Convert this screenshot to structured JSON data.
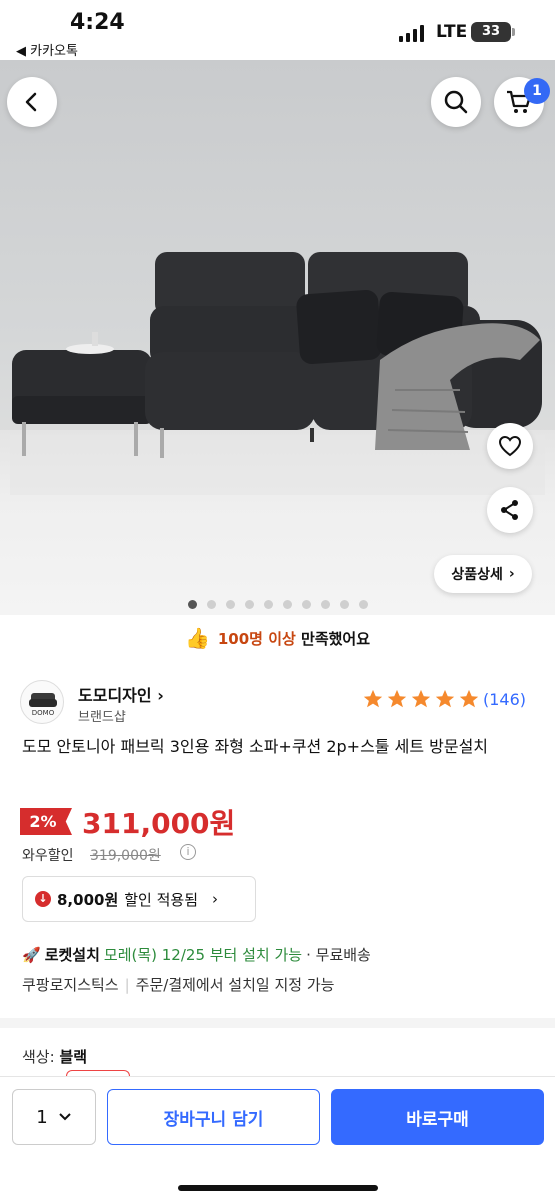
{
  "status_bar": {
    "time": "4:24",
    "back_app": "◀ 카카오톡",
    "network": "LTE",
    "battery": "33"
  },
  "hero": {
    "image_desc_icon": "sofa-photo",
    "detail_button": "상품상세",
    "carousel_total": 10,
    "carousel_active": 0,
    "cart_count": "1"
  },
  "satisfaction": {
    "count_text": "100명 이상",
    "rest_text": "만족했어요"
  },
  "seller": {
    "name": "도모디자인",
    "subtitle": "브랜드샵",
    "logo_text": "DOMO",
    "rating": 5,
    "review_count": "(146)"
  },
  "product": {
    "title": "도모 안토니아 패브릭 3인용 좌형 소파+쿠션 2p+스툴 세트 방문설치",
    "discount": "2%",
    "price": "311,000원",
    "wow_label": "와우할인",
    "original_price": "319,000원",
    "coupon_amount": "8,000원",
    "coupon_text": "할인 적용됨"
  },
  "delivery": {
    "rocket_label": "로켓설치",
    "date_text": "모레(목) 12/25 부터 설치 가능",
    "shipping": "· 무료배송",
    "logistics": "쿠팡로지스틱스",
    "install_note": "주문/결제에서 설치일 지정 가능"
  },
  "option": {
    "label": "색상:",
    "value": "블랙"
  },
  "bottom_bar": {
    "quantity": "1",
    "cart_button": "장바구니 담기",
    "buy_button": "바로구매"
  },
  "colors": {
    "accent": "#346aff",
    "price_red": "#d62d2d",
    "star": "#f5892d",
    "green": "#2d8b3c"
  }
}
